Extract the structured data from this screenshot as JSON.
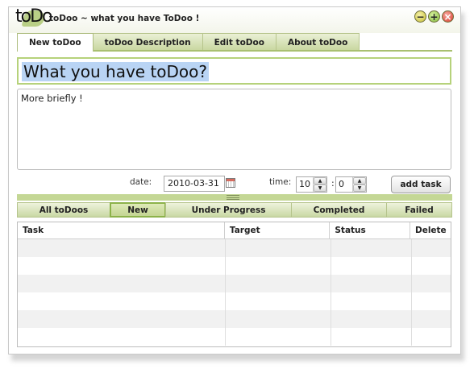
{
  "window": {
    "logo_text": "toDo",
    "title": "toDoo ~ what you have ToDoo !",
    "controls": {
      "minimize": "−",
      "maximize": "+",
      "close": "×"
    }
  },
  "tabs": [
    {
      "label": "New toDoo",
      "active": true
    },
    {
      "label": "toDoo Description",
      "active": false
    },
    {
      "label": "Edit toDoo",
      "active": false
    },
    {
      "label": "About toDoo",
      "active": false
    }
  ],
  "task_input": {
    "value": "What you have toDoo?"
  },
  "description": {
    "value": "More briefly !"
  },
  "date": {
    "label": "date:",
    "value": "2010-03-31"
  },
  "time": {
    "label": "time:",
    "hour": "10",
    "minute": "0",
    "separator": ":"
  },
  "add_button": {
    "label": "add task"
  },
  "filter_tabs": [
    {
      "label": "All toDoos",
      "active": false
    },
    {
      "label": "New",
      "active": true
    },
    {
      "label": "Under Progress",
      "active": false
    },
    {
      "label": "Completed",
      "active": false
    },
    {
      "label": "Failed",
      "active": false
    }
  ],
  "table": {
    "columns": [
      "Task",
      "Target",
      "Status",
      "Delete"
    ],
    "rows": []
  },
  "colors": {
    "accent_green": "#a9c070",
    "selection_blue": "#b9d4f4",
    "tab_gradient": "#c7d69e"
  }
}
